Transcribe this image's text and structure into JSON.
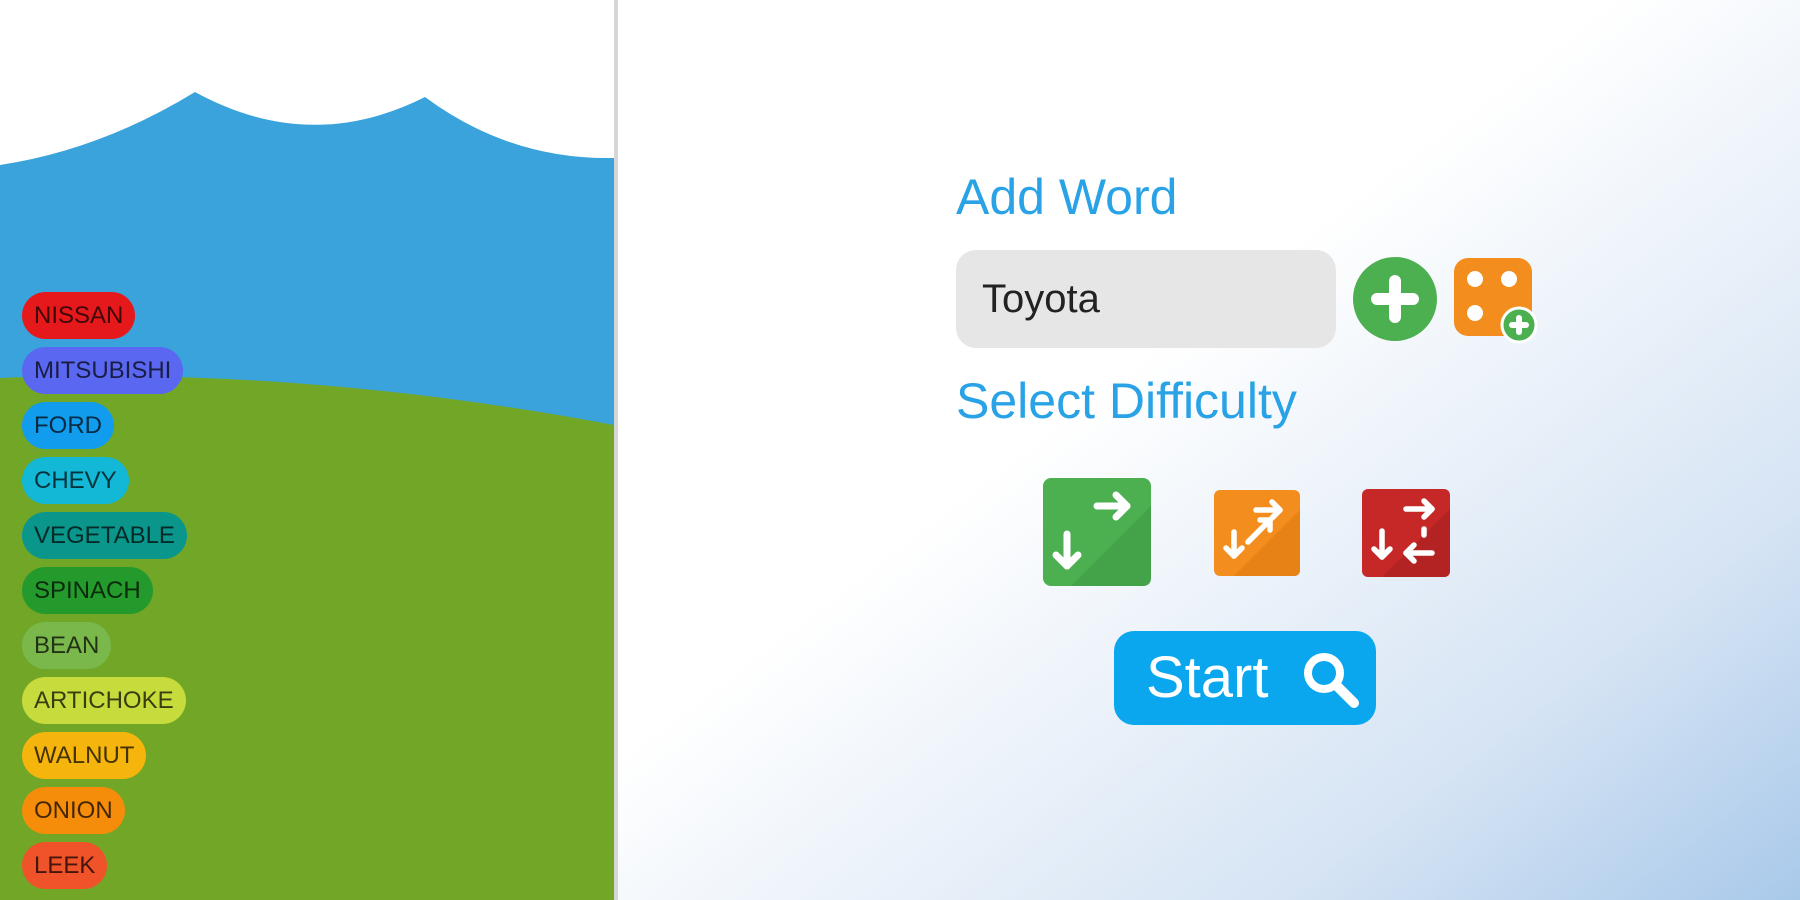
{
  "word_list": {
    "items": [
      {
        "label": "NISSAN",
        "color": "#e5191c"
      },
      {
        "label": "MITSUBISHI",
        "color": "#5a67f0"
      },
      {
        "label": "FORD",
        "color": "#129cee"
      },
      {
        "label": "CHEVY",
        "color": "#12b8d6"
      },
      {
        "label": "VEGETABLE",
        "color": "#0b968c"
      },
      {
        "label": "SPINACH",
        "color": "#239a2b"
      },
      {
        "label": "BEAN",
        "color": "#7ab84c"
      },
      {
        "label": "ARTICHOKE",
        "color": "#c8db3c"
      },
      {
        "label": "WALNUT",
        "color": "#f5b50c"
      },
      {
        "label": "ONION",
        "color": "#f58d0a"
      },
      {
        "label": "LEEK",
        "color": "#f0522a"
      }
    ]
  },
  "add_word": {
    "label": "Add Word",
    "input_value": "Toyota",
    "add_button_icon": "plus-circle-icon",
    "random_button_icon": "dice-plus-icon"
  },
  "difficulty": {
    "label": "Select Difficulty",
    "options": [
      {
        "name": "easy",
        "icon": "arrows-easy-icon",
        "color": "#4caf50"
      },
      {
        "name": "medium",
        "icon": "arrows-medium-icon",
        "color": "#f38e1e"
      },
      {
        "name": "hard",
        "icon": "arrows-hard-icon",
        "color": "#c62828"
      }
    ]
  },
  "start": {
    "label": "Start",
    "icon": "search-icon",
    "color": "#0aa7ef"
  },
  "theme": {
    "label_color": "#29a3e6",
    "sky_color": "#3aa3dc",
    "grass_color": "#72a626"
  }
}
